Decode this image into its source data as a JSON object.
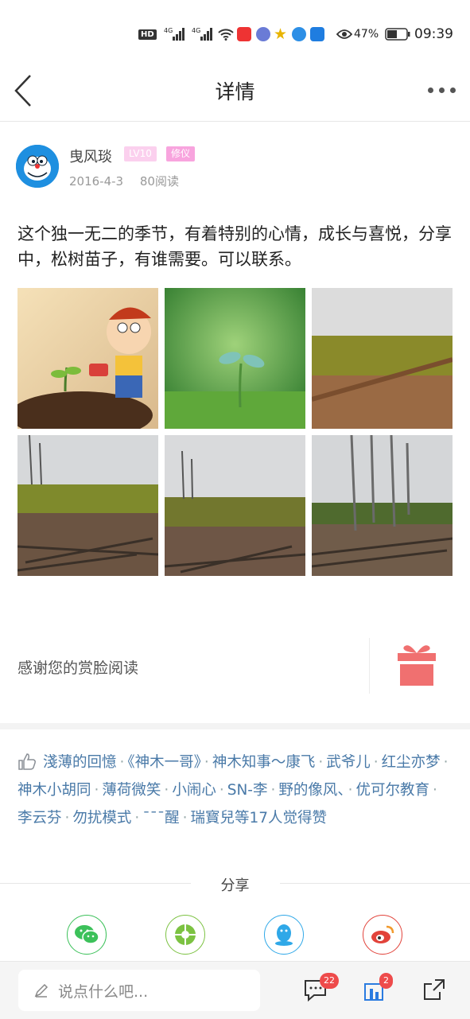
{
  "status_bar": {
    "hd": "HD",
    "net1": "4G",
    "net2": "4G",
    "battery": "47%",
    "time": "09:39"
  },
  "header": {
    "title": "详情"
  },
  "post": {
    "author": "曳风琰",
    "level": "LV10",
    "role": "修仪",
    "date": "2016-4-3",
    "reads": "80阅读",
    "content": "这个独一无二的季节，有着特别的心情，成长与喜悦，分享中，松树苗子，有谁需要。可以联系。"
  },
  "reward": {
    "text": "感谢您的赏脸阅读"
  },
  "likes": {
    "names": [
      "淺薄的回憶",
      "《神木一哥》",
      "神木知事～康飞",
      "武爷儿",
      "红尘亦梦",
      "神木小胡同",
      "薄荷微笑",
      "小闹心",
      "SN-李",
      "野的像风、",
      "优可尔教育",
      "李云芬",
      "勿扰模式",
      "¯¯¯醒",
      "瑞寳兒等"
    ],
    "summary": "17人觉得赞"
  },
  "share": {
    "title": "分享",
    "items": [
      {
        "name": "wechat-icon",
        "color": "#3cc15a"
      },
      {
        "name": "moments-icon",
        "color": "#7cc242"
      },
      {
        "name": "qq-icon",
        "color": "#2fa8e8"
      },
      {
        "name": "weibo-icon",
        "color": "#e2433b"
      }
    ]
  },
  "bottom_bar": {
    "placeholder": "说点什么吧...",
    "comments_badge": "22",
    "favorites_badge": "2"
  }
}
